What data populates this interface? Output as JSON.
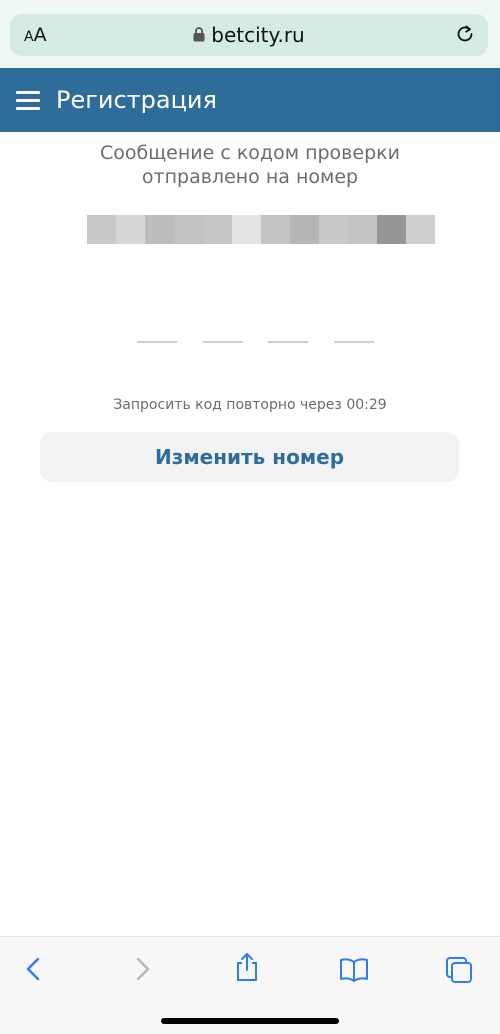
{
  "browser": {
    "text_size_label_small": "A",
    "text_size_label_large": "A",
    "url": "betcity.ru",
    "icons": {
      "lock": "lock-icon",
      "reload": "reload-icon"
    }
  },
  "header": {
    "title": "Регистрация",
    "background": "#2e6c9a",
    "menu_icon": "hamburger-menu-icon"
  },
  "verification": {
    "message_line1": "Сообщение с кодом проверки",
    "message_line2": "отправлено на номер",
    "phone_number_state": "blurred",
    "code_length": 4,
    "code_value": "",
    "resend_text": "Запросить код повторно через 00:29"
  },
  "actions": {
    "change_number_label": "Изменить номер",
    "accent_color": "#2e6c9a"
  },
  "toolbar": {
    "buttons": [
      "back-icon",
      "forward-icon",
      "share-icon",
      "bookmarks-icon",
      "tabs-icon"
    ],
    "back_color": "#2f7bf5",
    "disabled_color": "#b7b7b7"
  }
}
